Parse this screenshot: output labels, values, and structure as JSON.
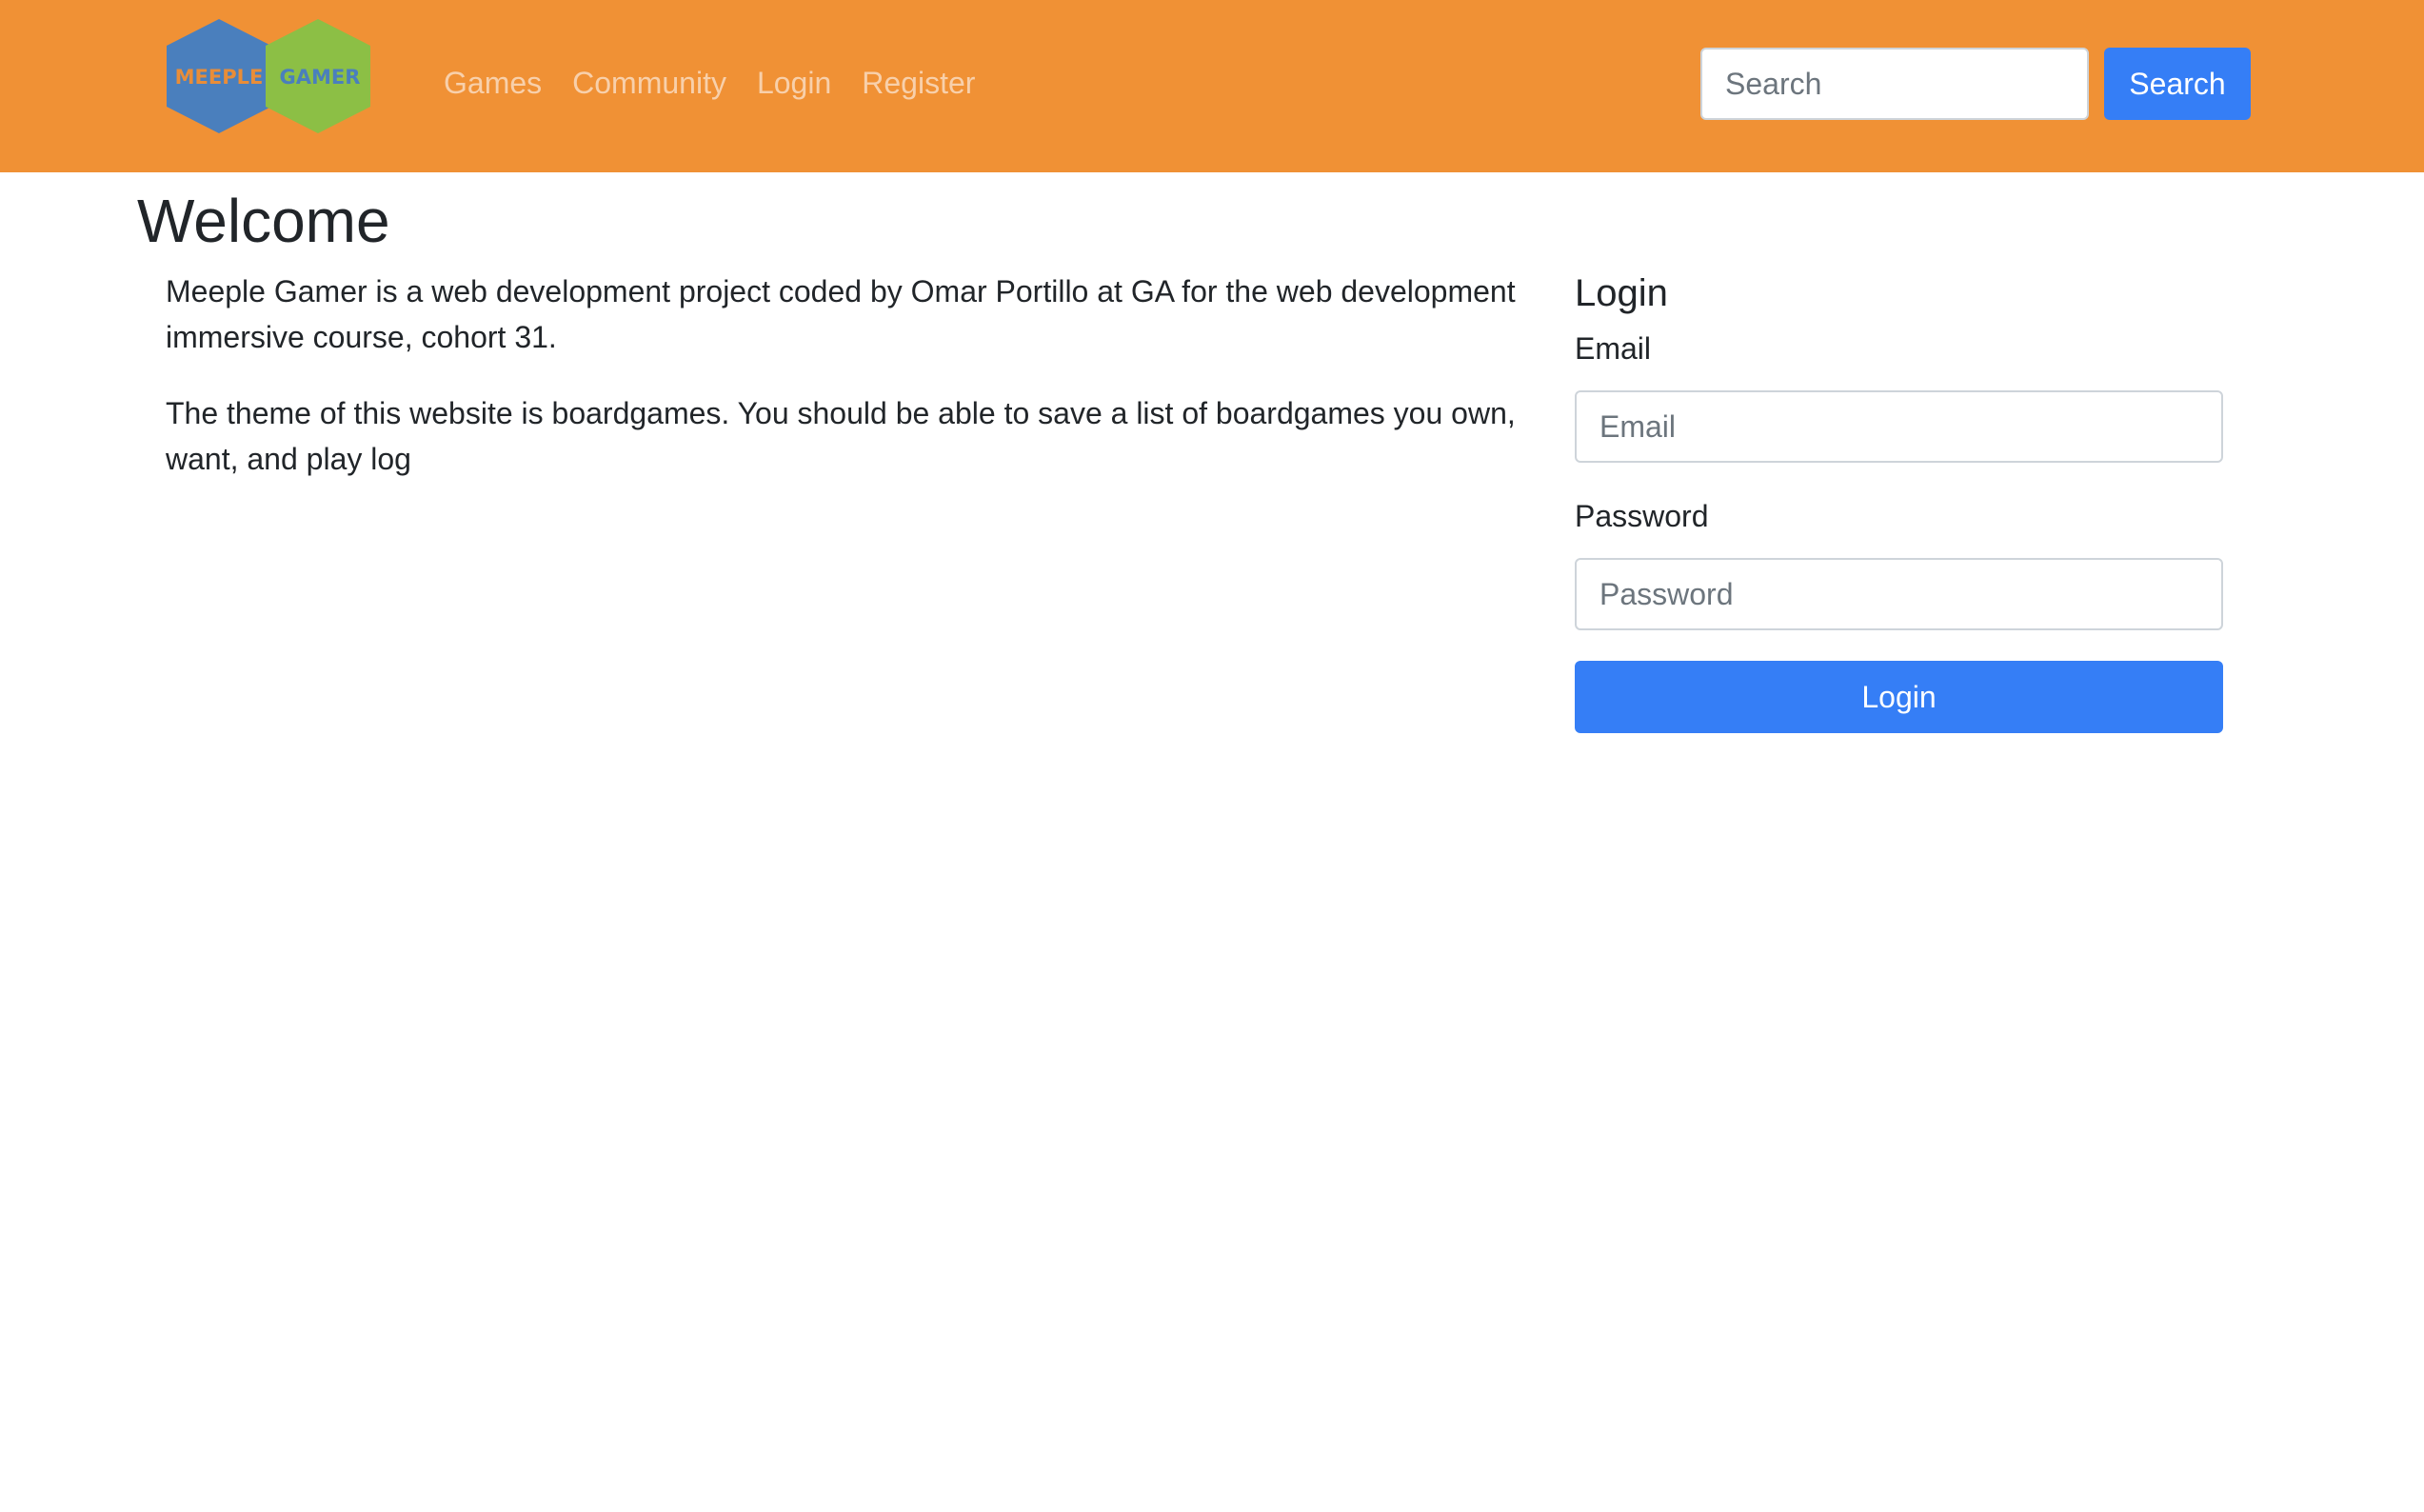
{
  "brand": {
    "logo_left_text": "MEEPLE",
    "logo_right_text": "GAMER",
    "colors": {
      "navbar_bg": "#f09135",
      "hex_blue": "#4a7fbd",
      "hex_green": "#8cbf45",
      "accent_button": "#357ef6"
    }
  },
  "nav": {
    "links": [
      {
        "label": "Games"
      },
      {
        "label": "Community"
      },
      {
        "label": "Login"
      },
      {
        "label": "Register"
      }
    ],
    "search": {
      "placeholder": "Search",
      "button_label": "Search"
    }
  },
  "main": {
    "title": "Welcome",
    "paragraphs": [
      "Meeple Gamer is a web development project coded by Omar Portillo at GA for the web development immersive course, cohort 31.",
      "The theme of this website is boardgames. You should be able to save a list of boardgames you own, want, and play log"
    ]
  },
  "login_form": {
    "heading": "Login",
    "email_label": "Email",
    "email_placeholder": "Email",
    "password_label": "Password",
    "password_placeholder": "Password",
    "submit_label": "Login"
  }
}
